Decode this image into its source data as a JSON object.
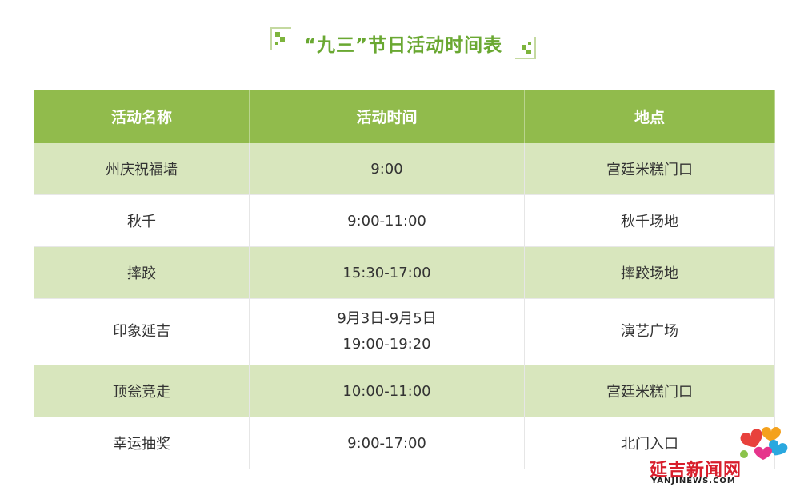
{
  "title": "“九三”节日活动时间表",
  "table": {
    "headers": [
      "活动名称",
      "活动时间",
      "地点"
    ],
    "rows": [
      {
        "name": "州庆祝福墙",
        "time": [
          "9:00"
        ],
        "place": "宫廷米糕门口"
      },
      {
        "name": "秋千",
        "time": [
          "9:00-11:00"
        ],
        "place": "秋千场地"
      },
      {
        "name": "摔跤",
        "time": [
          "15:30-17:00"
        ],
        "place": "摔跤场地"
      },
      {
        "name": "印象延吉",
        "time": [
          "9月3日-9月5日",
          "19:00-19:20"
        ],
        "place": "演艺广场"
      },
      {
        "name": "顶瓮竞走",
        "time": [
          "10:00-11:00"
        ],
        "place": "宫廷米糕门口"
      },
      {
        "name": "幸运抽奖",
        "time": [
          "9:00-17:00"
        ],
        "place": "北门入口"
      }
    ]
  },
  "watermark": {
    "name": "延吉新闻网",
    "url": "YANJINEWS.COM",
    "colors": [
      "#e8413c",
      "#f4a11d",
      "#2aa8df",
      "#e6348c",
      "#8bc34a"
    ]
  },
  "theme": {
    "header_bg": "#91bb4c",
    "row_green": "#d8e6bd",
    "title_color": "#6aa832"
  }
}
